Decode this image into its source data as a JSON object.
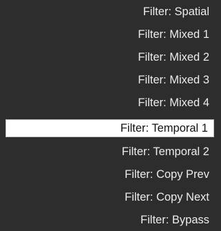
{
  "menu": {
    "selected_index": 5,
    "items": [
      {
        "label": "Filter: Spatial"
      },
      {
        "label": "Filter: Mixed 1"
      },
      {
        "label": "Filter: Mixed 2"
      },
      {
        "label": "Filter: Mixed 3"
      },
      {
        "label": "Filter: Mixed 4"
      },
      {
        "label": "Filter: Temporal 1"
      },
      {
        "label": "Filter: Temporal 2"
      },
      {
        "label": "Filter: Copy Prev"
      },
      {
        "label": "Filter: Copy Next"
      },
      {
        "label": "Filter: Bypass"
      }
    ]
  },
  "colors": {
    "background": "#2d2d2d",
    "text": "#ececec",
    "selected_background": "#ffffff",
    "selected_text": "#111111"
  }
}
